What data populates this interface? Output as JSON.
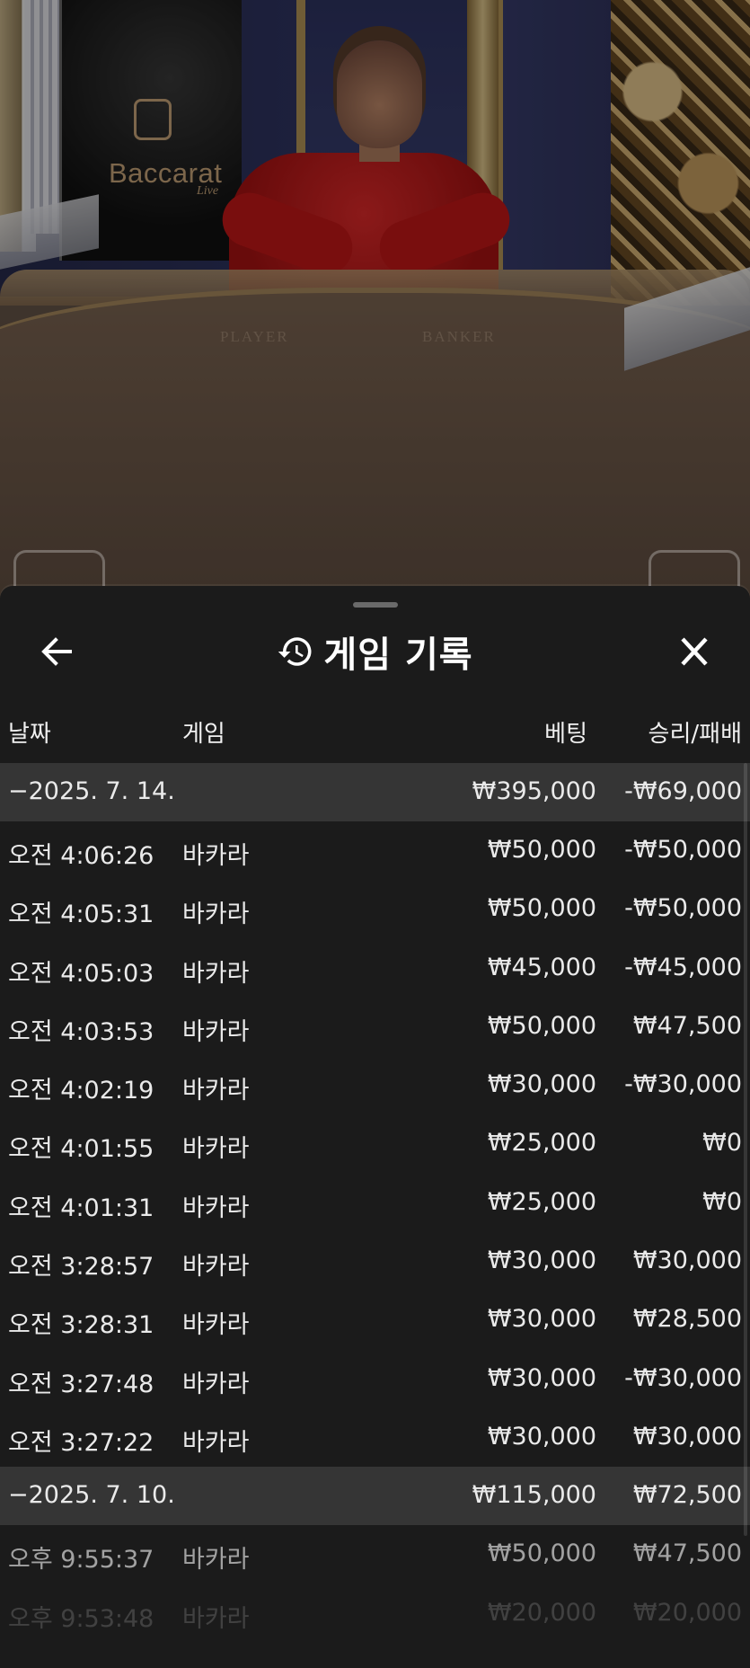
{
  "video": {
    "brand_title": "Baccarat",
    "brand_subtitle": "Live",
    "player_label": "PLAYER",
    "banker_label": "BANKER"
  },
  "sheet": {
    "title": "게임 기록",
    "back_icon": "arrow-left-icon",
    "history_icon": "history-icon",
    "close_icon": "close-icon"
  },
  "columns": {
    "date": "날짜",
    "game": "게임",
    "bet": "베팅",
    "result": "승리/패배"
  },
  "groups": [
    {
      "date": "−2025. 7. 14.",
      "bet_total": "₩395,000",
      "result_total": "-₩69,000",
      "rows": [
        {
          "time": "오전 4:06:26",
          "game": "바카라",
          "bet": "₩50,000",
          "result": "-₩50,000"
        },
        {
          "time": "오전 4:05:31",
          "game": "바카라",
          "bet": "₩50,000",
          "result": "-₩50,000"
        },
        {
          "time": "오전 4:05:03",
          "game": "바카라",
          "bet": "₩45,000",
          "result": "-₩45,000"
        },
        {
          "time": "오전 4:03:53",
          "game": "바카라",
          "bet": "₩50,000",
          "result": "₩47,500"
        },
        {
          "time": "오전 4:02:19",
          "game": "바카라",
          "bet": "₩30,000",
          "result": "-₩30,000"
        },
        {
          "time": "오전 4:01:55",
          "game": "바카라",
          "bet": "₩25,000",
          "result": "₩0"
        },
        {
          "time": "오전 4:01:31",
          "game": "바카라",
          "bet": "₩25,000",
          "result": "₩0"
        },
        {
          "time": "오전 3:28:57",
          "game": "바카라",
          "bet": "₩30,000",
          "result": "₩30,000"
        },
        {
          "time": "오전 3:28:31",
          "game": "바카라",
          "bet": "₩30,000",
          "result": "₩28,500"
        },
        {
          "time": "오전 3:27:48",
          "game": "바카라",
          "bet": "₩30,000",
          "result": "-₩30,000"
        },
        {
          "time": "오전 3:27:22",
          "game": "바카라",
          "bet": "₩30,000",
          "result": "₩30,000"
        }
      ]
    },
    {
      "date": "−2025. 7. 10.",
      "bet_total": "₩115,000",
      "result_total": "₩72,500",
      "rows": [
        {
          "time": "오후 9:55:37",
          "game": "바카라",
          "bet": "₩50,000",
          "result": "₩47,500"
        },
        {
          "time": "오후 9:53:48",
          "game": "바카라",
          "bet": "₩20,000",
          "result": "₩20,000"
        }
      ]
    }
  ]
}
